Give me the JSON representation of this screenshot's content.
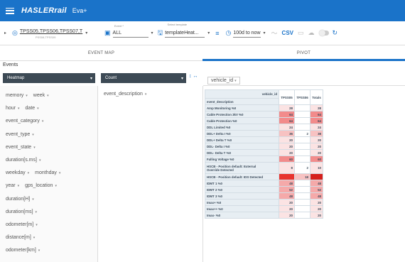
{
  "app": {
    "brand": "HASLERrail",
    "name": "Eva+"
  },
  "toolbar": {
    "vehicles": "TPSS05,TPSS06,TPSS07,T",
    "vehicles_sub": "PSS08,TPSS09",
    "event_label": "Event *",
    "event_value": "ALL",
    "template_label": "Select template",
    "template_value": "templateHeat...",
    "time_range": "100d to now",
    "csv": "CSV"
  },
  "tabs": [
    {
      "label": "EVENT MAP",
      "active": false
    },
    {
      "label": "PIVOT",
      "active": true
    }
  ],
  "events_label": "Events",
  "renderer": "Heatmap",
  "aggregator": "Count",
  "column_field": "vehicle_id",
  "row_field": "event_description",
  "fields": [
    [
      "memory",
      "week"
    ],
    [
      "hour",
      "date"
    ],
    [
      "event_category"
    ],
    [
      "event_type"
    ],
    [
      "event_state"
    ],
    [
      "duration[s.ms]"
    ],
    [
      "weekday",
      "monthday"
    ],
    [
      "year",
      "gps_location"
    ],
    [
      "duration[H]"
    ],
    [
      "duration[ms]"
    ],
    [
      "odometer[m]"
    ],
    [
      "distance[m]"
    ],
    [
      "odometer[km]"
    ]
  ],
  "pivot": {
    "col_attr": "vehicle_id",
    "row_attr": "event_description",
    "columns": [
      "TPSS05",
      "TPSS06",
      "Totals"
    ],
    "rows": [
      {
        "label": "Amp Monitoring %0",
        "values": [
          "28",
          "",
          "28"
        ]
      },
      {
        "label": "Cable Protection 3kV %0",
        "values": [
          "64",
          "",
          "64"
        ]
      },
      {
        "label": "Cable Protection %0",
        "values": [
          "64",
          "",
          "64"
        ]
      },
      {
        "label": "DDL Limited %0",
        "values": [
          "24",
          "",
          "24"
        ]
      },
      {
        "label": "DDL+ Delta I %0",
        "values": [
          "36",
          "2",
          "38"
        ]
      },
      {
        "label": "DDL+ Delta T %0",
        "values": [
          "20",
          "",
          "20"
        ]
      },
      {
        "label": "DDL- Delta I %0",
        "values": [
          "20",
          "",
          "20"
        ]
      },
      {
        "label": "DDL- Delta T %0",
        "values": [
          "20",
          "",
          "20"
        ]
      },
      {
        "label": "Falling Voltage %0",
        "values": [
          "60",
          "",
          "60"
        ]
      },
      {
        "label": "HSCB - Position default: External",
        "label2": "Override Detected",
        "values": [
          "8",
          "2",
          "10"
        ]
      },
      {
        "label": "HSCB - Position default: IDS Detected",
        "values": [
          "",
          "18",
          ""
        ]
      },
      {
        "label": "IDMT 1 %0",
        "values": [
          "48",
          "",
          "48"
        ]
      },
      {
        "label": "IDMT 2 %0",
        "values": [
          "52",
          "",
          "52"
        ]
      },
      {
        "label": "IDMT 3 %0",
        "values": [
          "48",
          "",
          "48"
        ]
      },
      {
        "label": "Imax+ %0",
        "values": [
          "20",
          "",
          "20"
        ]
      },
      {
        "label": "Imax++ %0",
        "values": [
          "20",
          "",
          "20"
        ]
      },
      {
        "label": "Imax- %0",
        "values": [
          "20",
          "",
          "20"
        ]
      }
    ],
    "heat_colors": {
      "low": "#fbe3e3",
      "mid": "#f28b8b",
      "high": "#e8332e"
    }
  }
}
